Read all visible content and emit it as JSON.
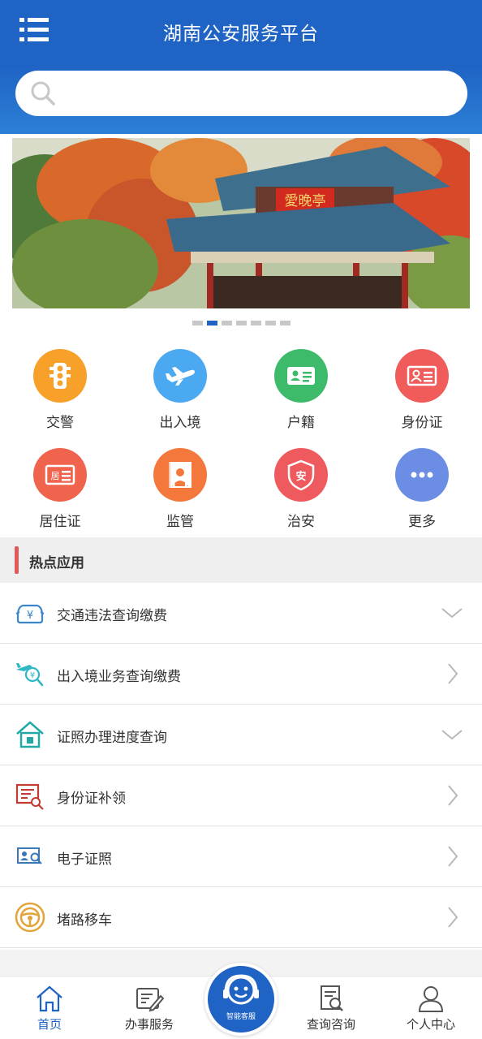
{
  "header": {
    "title": "湖南公安服务平台",
    "menu_icon": "menu-icon",
    "search": {
      "placeholder": "",
      "icon": "search-icon"
    }
  },
  "banner": {
    "sign_text": "愛晚亭",
    "page_count": 7,
    "active_index": 1
  },
  "services": [
    {
      "label": "交警",
      "icon": "traffic-light-icon",
      "color": "#f7a12a"
    },
    {
      "label": "出入境",
      "icon": "airplane-icon",
      "color": "#4aa9f0"
    },
    {
      "label": "户籍",
      "icon": "household-card-icon",
      "color": "#3dbb6b"
    },
    {
      "label": "身份证",
      "icon": "id-card-icon",
      "color": "#ef5c5a"
    },
    {
      "label": "居住证",
      "icon": "residence-permit-icon",
      "color": "#f0644d"
    },
    {
      "label": "监管",
      "icon": "detention-icon",
      "color": "#f4783b"
    },
    {
      "label": "治安",
      "icon": "security-shield-icon",
      "color": "#ee5a5e"
    },
    {
      "label": "更多",
      "icon": "more-icon",
      "color": "#6b8de3"
    }
  ],
  "hot_section": {
    "title": "热点应用",
    "items": [
      {
        "label": "交通违法查询缴费",
        "icon": "car-fine-icon",
        "arrow": "chevron-down-icon"
      },
      {
        "label": "出入境业务查询缴费",
        "icon": "exit-entry-search-icon",
        "arrow": "chevron-right-icon"
      },
      {
        "label": "证照办理进度查询",
        "icon": "house-progress-icon",
        "arrow": "chevron-down-icon"
      },
      {
        "label": "身份证补领",
        "icon": "id-reissue-icon",
        "arrow": "chevron-right-icon"
      },
      {
        "label": "电子证照",
        "icon": "e-license-icon",
        "arrow": "chevron-right-icon"
      },
      {
        "label": "堵路移车",
        "icon": "steering-wheel-icon",
        "arrow": "chevron-right-icon"
      }
    ]
  },
  "bottom_nav": {
    "items": [
      {
        "label": "首页",
        "icon": "home-icon",
        "active": true
      },
      {
        "label": "办事服务",
        "icon": "document-edit-icon",
        "active": false
      },
      {
        "label": "查询咨询",
        "icon": "document-search-icon",
        "active": false
      },
      {
        "label": "个人中心",
        "icon": "user-icon",
        "active": false
      }
    ],
    "center": {
      "label": "智能客服",
      "icon": "customer-service-icon"
    }
  },
  "colors": {
    "primary": "#1f63c4",
    "accent_red": "#e05a59"
  }
}
